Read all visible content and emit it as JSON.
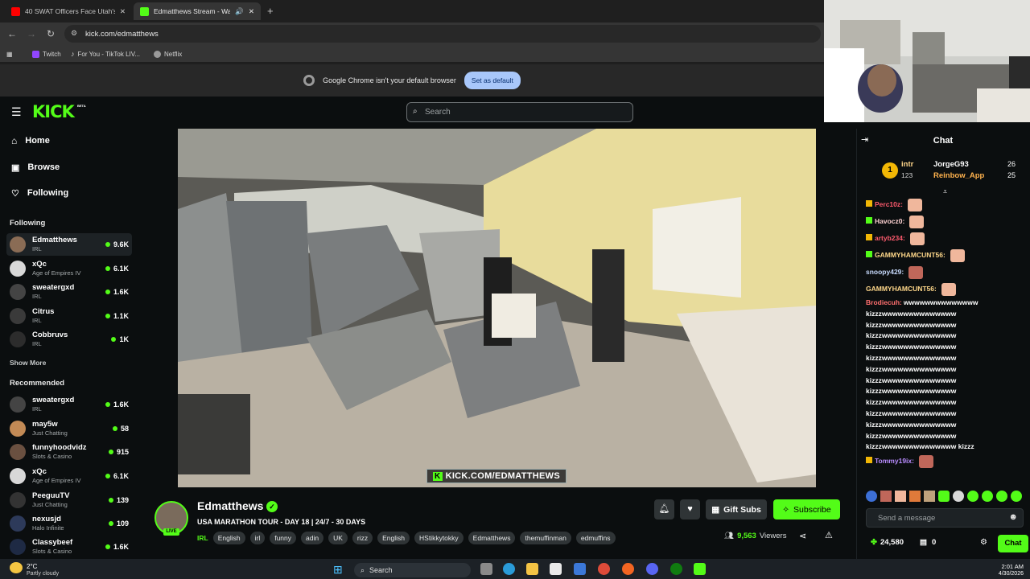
{
  "browser": {
    "tabs": [
      {
        "label": "40 SWAT Officers Face Utah's D",
        "active": false
      },
      {
        "label": "Edmatthews Stream - Watch",
        "active": true
      }
    ],
    "url": "kick.com/edmatthews",
    "bookmarks": [
      "Twitch",
      "For You - TikTok LIV...",
      "Netflix"
    ],
    "infobar": {
      "message": "Google Chrome isn't your default browser",
      "button": "Set as default"
    }
  },
  "kick": {
    "logo": "KICK",
    "logo_badge": "BETA",
    "search_placeholder": "Search",
    "nav": [
      "Home",
      "Browse",
      "Following"
    ],
    "following_heading": "Following",
    "following": [
      {
        "name": "Edmatthews",
        "category": "IRL",
        "viewers": "9.6K"
      },
      {
        "name": "xQc",
        "category": "Age of Empires IV",
        "viewers": "6.1K"
      },
      {
        "name": "sweatergxd",
        "category": "IRL",
        "viewers": "1.6K"
      },
      {
        "name": "Citrus",
        "category": "IRL",
        "viewers": "1.1K"
      },
      {
        "name": "Cobbruvs",
        "category": "IRL",
        "viewers": "1K"
      }
    ],
    "show_more": "Show More",
    "recommended_heading": "Recommended",
    "recommended": [
      {
        "name": "sweatergxd",
        "category": "IRL",
        "viewers": "1.6K"
      },
      {
        "name": "may5w",
        "category": "Just Chatting",
        "viewers": "58"
      },
      {
        "name": "funnyhoodvidz",
        "category": "Slots & Casino",
        "viewers": "915"
      },
      {
        "name": "xQc",
        "category": "Age of Empires IV",
        "viewers": "6.1K"
      },
      {
        "name": "PeeguuTV",
        "category": "Just Chatting",
        "viewers": "139"
      },
      {
        "name": "nexusjd",
        "category": "Halo Infinite",
        "viewers": "109"
      },
      {
        "name": "Classybeef",
        "category": "Slots & Casino",
        "viewers": "1.6K"
      }
    ],
    "video_watermark": "KICK.COM/EDMATTHEWS",
    "stream": {
      "name": "Edmatthews",
      "live_label": "LIVE",
      "title": "USA MARATHON TOUR - DAY 18 | 24/7 - 30 DAYS",
      "category": "IRL",
      "tags": [
        "English",
        "irl",
        "funny",
        "adin",
        "UK",
        "rizz",
        "English",
        "HStikkytokky",
        "Edmatthews",
        "themuffinman",
        "edmuffins"
      ],
      "viewers": "9,563",
      "viewers_label": "Viewers",
      "gift_label": "Gift Subs",
      "subscribe_label": "Subscribe"
    },
    "chat": {
      "title": "Chat",
      "pinned": [
        {
          "rank": "1",
          "name": "intr",
          "count": "123"
        },
        {
          "rank": "",
          "name": "JorgeG93",
          "count": "26"
        },
        {
          "rank": "",
          "name": "Reinbow_App",
          "count": "25"
        }
      ],
      "messages": [
        {
          "user": "Perc10z:",
          "text": "",
          "color": "#ff5b6e"
        },
        {
          "user": "Havocz0:",
          "text": "",
          "color": "#ffd3d3"
        },
        {
          "user": "artyb234:",
          "text": "",
          "color": "#ff5b6e"
        },
        {
          "user": "GAMMYHAMCUNT56:",
          "text": "",
          "color": "#ffd88a"
        },
        {
          "user": "snoopy429:",
          "text": "",
          "color": "#c9dcff"
        },
        {
          "user": "GAMMYHAMCUNT56:",
          "text": "",
          "color": "#ffd88a"
        },
        {
          "user": "Brodiecuh:",
          "text": "wwwwwwwwwwwwww",
          "color": "#ff6f6f"
        },
        {
          "user": "",
          "text": "kizzzwwwwwwwwwwwwww",
          "color": "#fff"
        },
        {
          "user": "",
          "text": "kizzzwwwwwwwwwwwwww",
          "color": "#fff"
        },
        {
          "user": "",
          "text": "kizzzwwwwwwwwwwwwww",
          "color": "#fff"
        },
        {
          "user": "",
          "text": "kizzzwwwwwwwwwwwwww",
          "color": "#fff"
        },
        {
          "user": "",
          "text": "kizzzwwwwwwwwwwwwww",
          "color": "#fff"
        },
        {
          "user": "",
          "text": "kizzzwwwwwwwwwwwwww",
          "color": "#fff"
        },
        {
          "user": "",
          "text": "kizzzwwwwwwwwwwwwww",
          "color": "#fff"
        },
        {
          "user": "",
          "text": "kizzzwwwwwwwwwwwwww",
          "color": "#fff"
        },
        {
          "user": "",
          "text": "kizzzwwwwwwwwwwwwww",
          "color": "#fff"
        },
        {
          "user": "",
          "text": "kizzzwwwwwwwwwwwwww",
          "color": "#fff"
        },
        {
          "user": "",
          "text": "kizzzwwwwwwwwwwwwww",
          "color": "#fff"
        },
        {
          "user": "",
          "text": "kizzzwwwwwwwwwwwwww",
          "color": "#fff"
        },
        {
          "user": "",
          "text": "kizzzwwwwwwwwwwwwww kizzz",
          "color": "#fff"
        },
        {
          "user": "Tommy19ix:",
          "text": "",
          "color": "#b98cff"
        }
      ],
      "input_placeholder": "Send a message",
      "points": "24,580",
      "drops": "0",
      "send_label": "Chat"
    }
  },
  "taskbar": {
    "weather_temp": "2°C",
    "weather_desc": "Partly cloudy",
    "search": "Search",
    "time": "2:01 AM",
    "date": "4/30/2026"
  },
  "colors": {
    "kick_green": "#53fc18",
    "bg": "#0b0e0f"
  }
}
